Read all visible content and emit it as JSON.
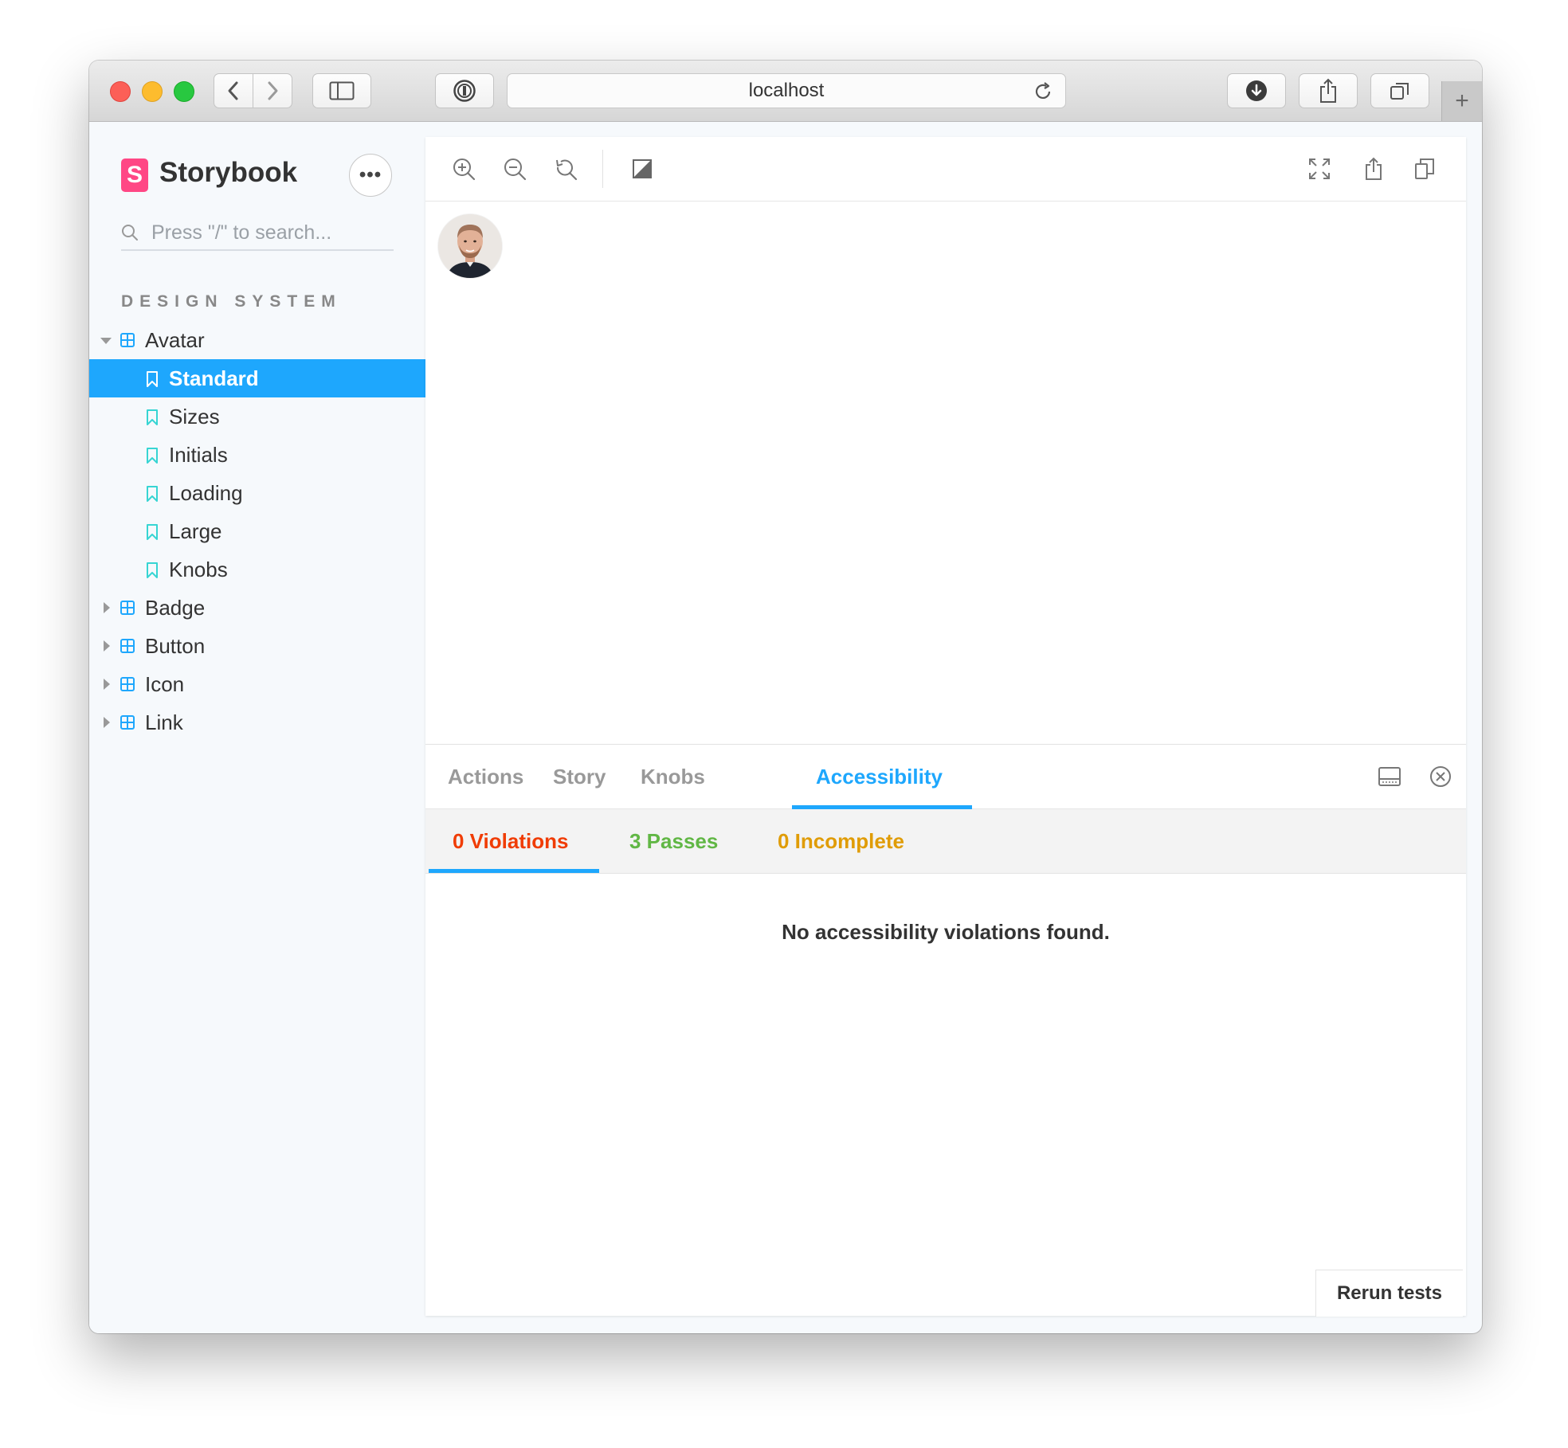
{
  "browser": {
    "url": "localhost",
    "new_tab": "+"
  },
  "sidebar": {
    "brand": "Storybook",
    "logo_letter": "S",
    "more_label": "•••",
    "search_placeholder": "Press \"/\" to search...",
    "section_title": "DESIGN SYSTEM",
    "tree": [
      {
        "label": "Avatar",
        "type": "component",
        "expanded": true
      },
      {
        "label": "Standard",
        "type": "story",
        "selected": true
      },
      {
        "label": "Sizes",
        "type": "story"
      },
      {
        "label": "Initials",
        "type": "story"
      },
      {
        "label": "Loading",
        "type": "story"
      },
      {
        "label": "Large",
        "type": "story"
      },
      {
        "label": "Knobs",
        "type": "story"
      },
      {
        "label": "Badge",
        "type": "component",
        "expanded": false
      },
      {
        "label": "Button",
        "type": "component",
        "expanded": false
      },
      {
        "label": "Icon",
        "type": "component",
        "expanded": false
      },
      {
        "label": "Link",
        "type": "component",
        "expanded": false
      }
    ]
  },
  "addons": {
    "tabs": [
      {
        "label": "Actions"
      },
      {
        "label": "Story"
      },
      {
        "label": "Knobs"
      },
      {
        "label": "Accessibility",
        "active": true
      }
    ],
    "subtabs": [
      {
        "label": "0 Violations",
        "color": "#f03c04"
      },
      {
        "label": "3 Passes",
        "color": "#61b745"
      },
      {
        "label": "0 Incomplete",
        "color": "#e09c06"
      }
    ],
    "empty_message": "No accessibility violations found.",
    "rerun_label": "Rerun tests"
  },
  "colors": {
    "accent": "#1ea7fd",
    "brand": "#ff4785",
    "story_icon": "#37d5d3"
  }
}
